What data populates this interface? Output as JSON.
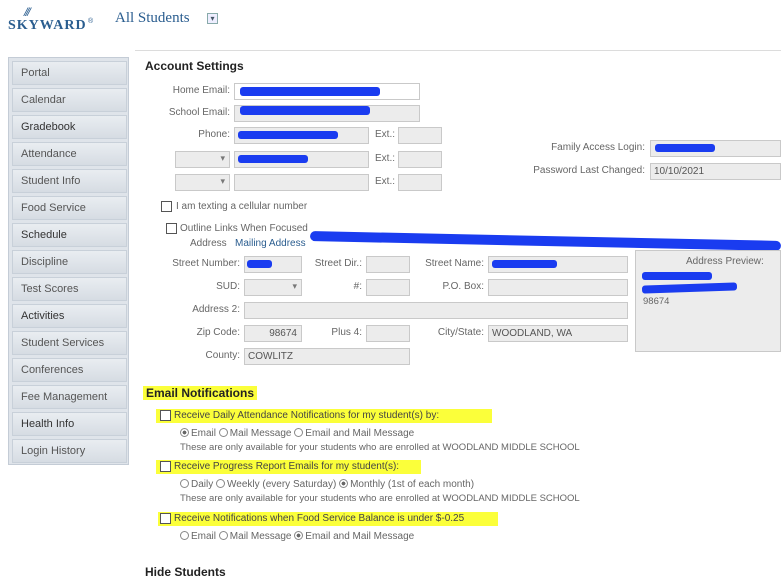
{
  "header": {
    "logo_mark": "///",
    "logo_word": "SKYWARD",
    "logo_tm": "®",
    "title": "All Students"
  },
  "sidebar": {
    "items": [
      {
        "label": "Portal"
      },
      {
        "label": "Calendar"
      },
      {
        "label": "Gradebook"
      },
      {
        "label": "Attendance"
      },
      {
        "label": "Student Info"
      },
      {
        "label": "Food Service"
      },
      {
        "label": "Schedule"
      },
      {
        "label": "Discipline"
      },
      {
        "label": "Test Scores"
      },
      {
        "label": "Activities"
      },
      {
        "label": "Student Services"
      },
      {
        "label": "Conferences"
      },
      {
        "label": "Fee Management"
      },
      {
        "label": "Health Info"
      },
      {
        "label": "Login History"
      }
    ]
  },
  "account": {
    "section_title": "Account Settings",
    "home_email_label": "Home Email:",
    "school_email_label": "School Email:",
    "phone_label": "Phone:",
    "ext_label": "Ext.:",
    "family_access_login_label": "Family Access Login:",
    "password_changed_label": "Password Last Changed:",
    "password_changed_value": "10/10/2021",
    "text_alert_label": "I am texting a cellular number",
    "outline_label": "Outline Links When Focused",
    "address_label": "Address",
    "mailing_address_link": "Mailing Address",
    "street_number_label": "Street Number:",
    "street_dir_label": "Street Dir.:",
    "street_name_label": "Street Name:",
    "suite_label": "SUD:",
    "num_label": "#:",
    "po_box_label": "P.O. Box:",
    "address2_label": "Address 2:",
    "zip_label": "Zip Code:",
    "zip_value": "98674",
    "plus4_label": "Plus 4:",
    "city_state_label": "City/State:",
    "city_state_value": "WOODLAND, WA",
    "county_label": "County:",
    "county_value": "COWLITZ",
    "address_preview_label": "Address Preview:",
    "address_preview_line": "98674"
  },
  "email_notifications": {
    "section_title": "Email Notifications",
    "attendance": {
      "label": "Receive Daily Attendance Notifications for my student(s) by:",
      "options": [
        "Email",
        "Mail Message",
        "Email and Mail Message"
      ],
      "note": "These are only available for your students who are enrolled at WOODLAND MIDDLE SCHOOL"
    },
    "progress": {
      "label": "Receive Progress Report Emails for my student(s):",
      "options": [
        "Daily",
        "Weekly (every Saturday)",
        "Monthly (1st of each month)"
      ],
      "note": "These are only available for your students who are enrolled at WOODLAND MIDDLE SCHOOL"
    },
    "food": {
      "label": "Receive Notifications when Food Service Balance is under $-0.25",
      "options": [
        "Email",
        "Mail Message",
        "Email and Mail Message"
      ]
    }
  },
  "hide_students": {
    "section_title": "Hide Students"
  },
  "colors": {
    "brand": "#2a5d8f",
    "highlight": "#fbff3a",
    "redaction": "#1a3cf0"
  }
}
